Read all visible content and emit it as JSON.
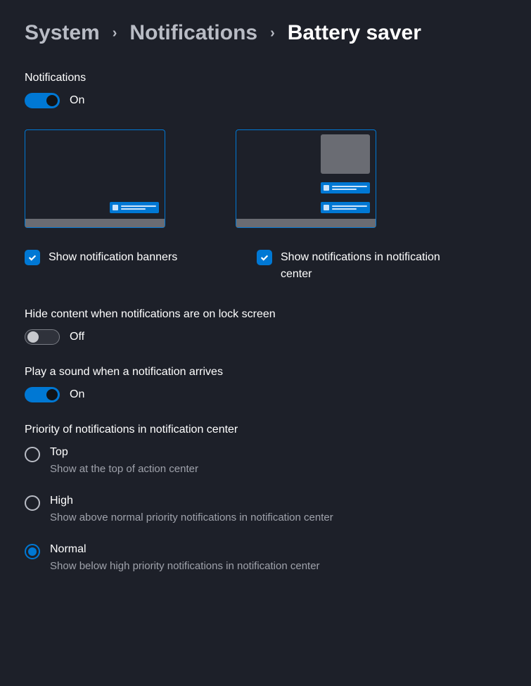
{
  "breadcrumb": {
    "items": [
      "System",
      "Notifications",
      "Battery saver"
    ]
  },
  "notifications": {
    "label": "Notifications",
    "state": "On",
    "on": true
  },
  "banner_checkbox": {
    "label": "Show notification banners",
    "checked": true
  },
  "center_checkbox": {
    "label": "Show notifications in notification center",
    "checked": true
  },
  "hide_content": {
    "label": "Hide content when notifications are on lock screen",
    "state": "Off",
    "on": false
  },
  "play_sound": {
    "label": "Play a sound when a notification arrives",
    "state": "On",
    "on": true
  },
  "priority": {
    "label": "Priority of notifications in notification center",
    "options": [
      {
        "label": "Top",
        "desc": "Show at the top of action center",
        "selected": false
      },
      {
        "label": "High",
        "desc": "Show above normal priority notifications in notification center",
        "selected": false
      },
      {
        "label": "Normal",
        "desc": "Show below high priority notifications in notification center",
        "selected": true
      }
    ]
  }
}
